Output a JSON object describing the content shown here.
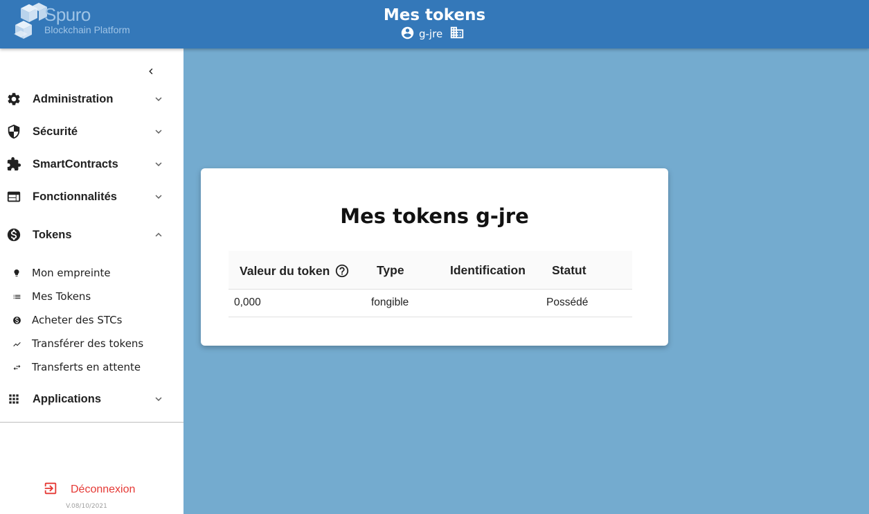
{
  "header": {
    "brand_name": "Spuro",
    "brand_subtitle": "Blockchain Platform",
    "title": "Mes tokens",
    "username": "g-jre",
    "icons": [
      "account-circle-icon",
      "building-icon"
    ],
    "background_color": "#3478b9"
  },
  "sidebar": {
    "items": [
      {
        "label": "Administration",
        "icon": "gear-icon",
        "expanded": false
      },
      {
        "label": "Sécurité",
        "icon": "shield-icon",
        "expanded": false
      },
      {
        "label": "SmartContracts",
        "icon": "puzzle-icon",
        "expanded": false
      },
      {
        "label": "Fonctionnalités",
        "icon": "web-window-icon",
        "expanded": false
      },
      {
        "label": "Tokens",
        "icon": "dollar-circle-icon",
        "expanded": true
      },
      {
        "label": "Applications",
        "icon": "apps-grid-icon",
        "expanded": false
      }
    ],
    "tokens_subitems": [
      {
        "label": "Mon empreinte",
        "icon": "lightbulb-icon"
      },
      {
        "label": "Mes Tokens",
        "icon": "list-icon"
      },
      {
        "label": "Acheter des STCs",
        "icon": "dollar-circle-icon"
      },
      {
        "label": "Transférer des tokens",
        "icon": "trending-icon"
      },
      {
        "label": "Transferts en attente",
        "icon": "swap-icon"
      }
    ],
    "logout_label": "Déconnexion",
    "version": "V.08/10/2021"
  },
  "card": {
    "title": "Mes tokens g-jre",
    "columns": [
      "Valeur du token",
      "Type",
      "Identification",
      "Statut"
    ],
    "rows": [
      {
        "value": "0,000",
        "type": "fongible",
        "identification": "",
        "status": "Possédé"
      }
    ]
  },
  "colors": {
    "page_background": "#74abcf",
    "logout": "#e53935"
  }
}
